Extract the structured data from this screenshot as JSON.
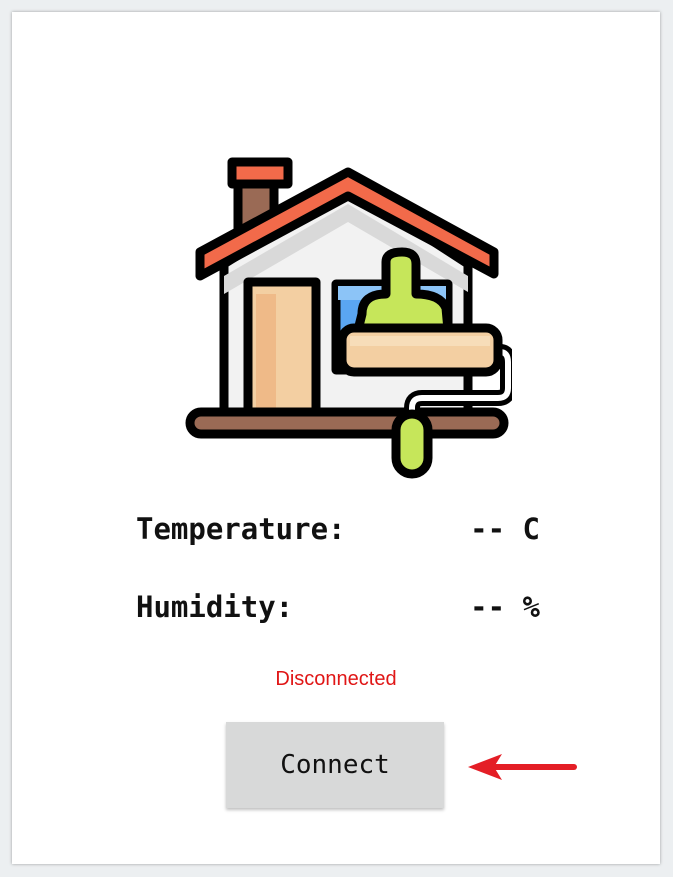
{
  "readings": {
    "temperature": {
      "label": "Temperature:",
      "value": "-- C"
    },
    "humidity": {
      "label": "Humidity:",
      "value": "-- %"
    }
  },
  "status": {
    "text": "Disconnected",
    "color": "#e01616"
  },
  "connect_button": {
    "label": "Connect"
  },
  "illustration": {
    "icon": "house-painting-icon"
  },
  "annotation": {
    "icon": "red-arrow-icon",
    "color": "#e41e26"
  }
}
